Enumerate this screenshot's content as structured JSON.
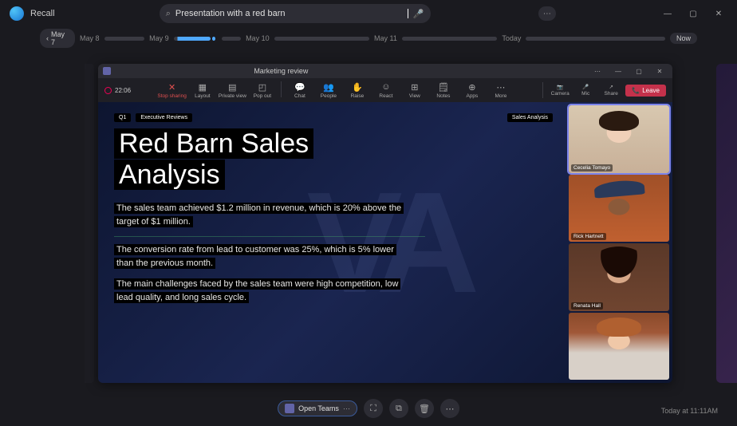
{
  "app_name": "Recall",
  "search": {
    "value": "Presentation with a red barn",
    "placeholder": ""
  },
  "timeline": {
    "prev_date": "May 7",
    "dates": [
      "May 8",
      "May 9",
      "May 10",
      "May 11",
      "Today"
    ],
    "now_label": "Now"
  },
  "snapshot": {
    "window_title": "Marketing review",
    "rec_time": "22:06",
    "tools": [
      "Stop sharing",
      "Layout",
      "Private view",
      "Pop out",
      "Chat",
      "People",
      "Raise",
      "React",
      "View",
      "Notes",
      "Apps",
      "More"
    ],
    "tool_icons": [
      "✕",
      "▦",
      "▤",
      "◰",
      "💬",
      "👥",
      "✋",
      "☺",
      "⊞",
      "🗒",
      "⊕",
      "⋯"
    ],
    "right_tools": [
      "Camera",
      "Mic",
      "Share"
    ],
    "right_icons": [
      "📷",
      "🎤",
      "↗"
    ],
    "leave_label": "Leave",
    "slide": {
      "chip_q": "Q1",
      "chip_exec": "Executive Reviews",
      "chip_right": "Sales Analysis",
      "title_line1": "Red Barn Sales",
      "title_line2": "Analysis",
      "para1": "The sales team achieved $1.2 million in revenue, which is 20% above the target of $1 million.",
      "para2": "The conversion rate from lead to customer was 25%, which is 5% lower than the previous month.",
      "para3": "The main challenges faced by the sales team were high competition, low lead quality, and long sales cycle."
    },
    "participants": [
      "Cecelia Tomayo",
      "Rick Hartnett",
      "Renata Hall",
      ""
    ]
  },
  "dock": {
    "open_label": "Open Teams"
  },
  "timestamp": "Today at 11:11AM"
}
